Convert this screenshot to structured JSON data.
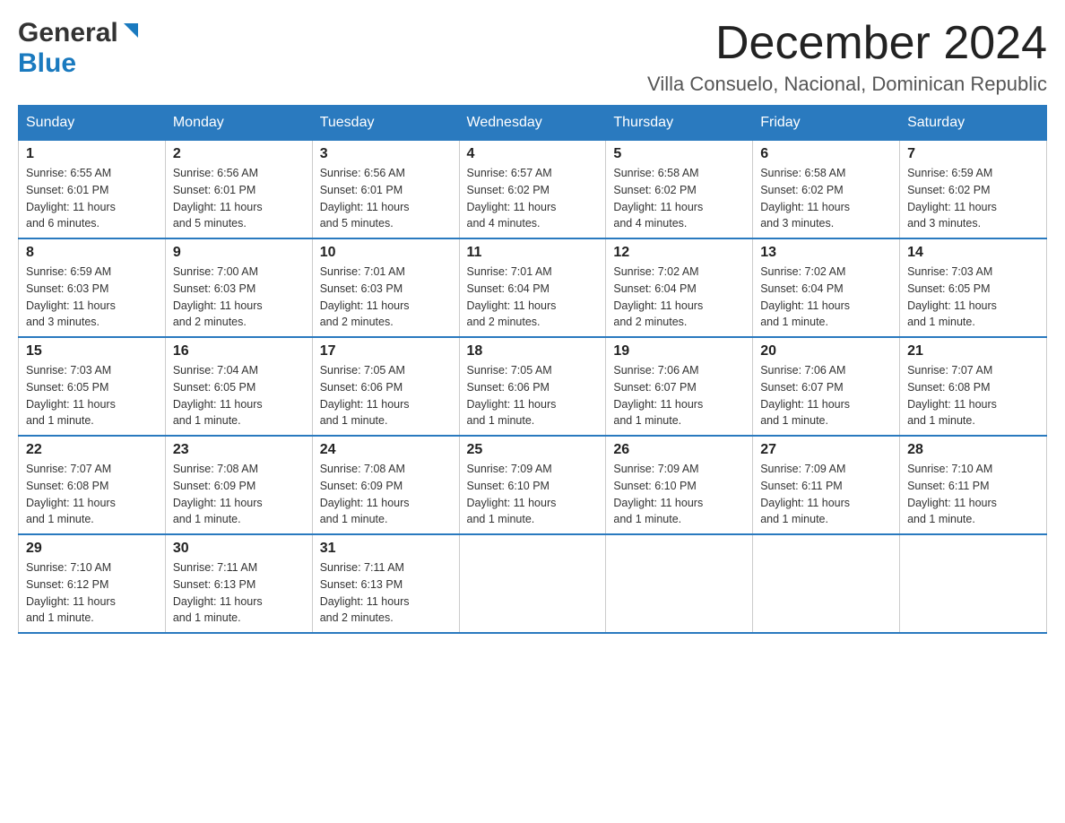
{
  "header": {
    "logo_general": "General",
    "logo_blue": "Blue",
    "month_title": "December 2024",
    "location": "Villa Consuelo, Nacional, Dominican Republic"
  },
  "days_of_week": [
    "Sunday",
    "Monday",
    "Tuesday",
    "Wednesday",
    "Thursday",
    "Friday",
    "Saturday"
  ],
  "weeks": [
    [
      {
        "day": "1",
        "sunrise": "Sunrise: 6:55 AM",
        "sunset": "Sunset: 6:01 PM",
        "daylight": "Daylight: 11 hours and 6 minutes."
      },
      {
        "day": "2",
        "sunrise": "Sunrise: 6:56 AM",
        "sunset": "Sunset: 6:01 PM",
        "daylight": "Daylight: 11 hours and 5 minutes."
      },
      {
        "day": "3",
        "sunrise": "Sunrise: 6:56 AM",
        "sunset": "Sunset: 6:01 PM",
        "daylight": "Daylight: 11 hours and 5 minutes."
      },
      {
        "day": "4",
        "sunrise": "Sunrise: 6:57 AM",
        "sunset": "Sunset: 6:02 PM",
        "daylight": "Daylight: 11 hours and 4 minutes."
      },
      {
        "day": "5",
        "sunrise": "Sunrise: 6:58 AM",
        "sunset": "Sunset: 6:02 PM",
        "daylight": "Daylight: 11 hours and 4 minutes."
      },
      {
        "day": "6",
        "sunrise": "Sunrise: 6:58 AM",
        "sunset": "Sunset: 6:02 PM",
        "daylight": "Daylight: 11 hours and 3 minutes."
      },
      {
        "day": "7",
        "sunrise": "Sunrise: 6:59 AM",
        "sunset": "Sunset: 6:02 PM",
        "daylight": "Daylight: 11 hours and 3 minutes."
      }
    ],
    [
      {
        "day": "8",
        "sunrise": "Sunrise: 6:59 AM",
        "sunset": "Sunset: 6:03 PM",
        "daylight": "Daylight: 11 hours and 3 minutes."
      },
      {
        "day": "9",
        "sunrise": "Sunrise: 7:00 AM",
        "sunset": "Sunset: 6:03 PM",
        "daylight": "Daylight: 11 hours and 2 minutes."
      },
      {
        "day": "10",
        "sunrise": "Sunrise: 7:01 AM",
        "sunset": "Sunset: 6:03 PM",
        "daylight": "Daylight: 11 hours and 2 minutes."
      },
      {
        "day": "11",
        "sunrise": "Sunrise: 7:01 AM",
        "sunset": "Sunset: 6:04 PM",
        "daylight": "Daylight: 11 hours and 2 minutes."
      },
      {
        "day": "12",
        "sunrise": "Sunrise: 7:02 AM",
        "sunset": "Sunset: 6:04 PM",
        "daylight": "Daylight: 11 hours and 2 minutes."
      },
      {
        "day": "13",
        "sunrise": "Sunrise: 7:02 AM",
        "sunset": "Sunset: 6:04 PM",
        "daylight": "Daylight: 11 hours and 1 minute."
      },
      {
        "day": "14",
        "sunrise": "Sunrise: 7:03 AM",
        "sunset": "Sunset: 6:05 PM",
        "daylight": "Daylight: 11 hours and 1 minute."
      }
    ],
    [
      {
        "day": "15",
        "sunrise": "Sunrise: 7:03 AM",
        "sunset": "Sunset: 6:05 PM",
        "daylight": "Daylight: 11 hours and 1 minute."
      },
      {
        "day": "16",
        "sunrise": "Sunrise: 7:04 AM",
        "sunset": "Sunset: 6:05 PM",
        "daylight": "Daylight: 11 hours and 1 minute."
      },
      {
        "day": "17",
        "sunrise": "Sunrise: 7:05 AM",
        "sunset": "Sunset: 6:06 PM",
        "daylight": "Daylight: 11 hours and 1 minute."
      },
      {
        "day": "18",
        "sunrise": "Sunrise: 7:05 AM",
        "sunset": "Sunset: 6:06 PM",
        "daylight": "Daylight: 11 hours and 1 minute."
      },
      {
        "day": "19",
        "sunrise": "Sunrise: 7:06 AM",
        "sunset": "Sunset: 6:07 PM",
        "daylight": "Daylight: 11 hours and 1 minute."
      },
      {
        "day": "20",
        "sunrise": "Sunrise: 7:06 AM",
        "sunset": "Sunset: 6:07 PM",
        "daylight": "Daylight: 11 hours and 1 minute."
      },
      {
        "day": "21",
        "sunrise": "Sunrise: 7:07 AM",
        "sunset": "Sunset: 6:08 PM",
        "daylight": "Daylight: 11 hours and 1 minute."
      }
    ],
    [
      {
        "day": "22",
        "sunrise": "Sunrise: 7:07 AM",
        "sunset": "Sunset: 6:08 PM",
        "daylight": "Daylight: 11 hours and 1 minute."
      },
      {
        "day": "23",
        "sunrise": "Sunrise: 7:08 AM",
        "sunset": "Sunset: 6:09 PM",
        "daylight": "Daylight: 11 hours and 1 minute."
      },
      {
        "day": "24",
        "sunrise": "Sunrise: 7:08 AM",
        "sunset": "Sunset: 6:09 PM",
        "daylight": "Daylight: 11 hours and 1 minute."
      },
      {
        "day": "25",
        "sunrise": "Sunrise: 7:09 AM",
        "sunset": "Sunset: 6:10 PM",
        "daylight": "Daylight: 11 hours and 1 minute."
      },
      {
        "day": "26",
        "sunrise": "Sunrise: 7:09 AM",
        "sunset": "Sunset: 6:10 PM",
        "daylight": "Daylight: 11 hours and 1 minute."
      },
      {
        "day": "27",
        "sunrise": "Sunrise: 7:09 AM",
        "sunset": "Sunset: 6:11 PM",
        "daylight": "Daylight: 11 hours and 1 minute."
      },
      {
        "day": "28",
        "sunrise": "Sunrise: 7:10 AM",
        "sunset": "Sunset: 6:11 PM",
        "daylight": "Daylight: 11 hours and 1 minute."
      }
    ],
    [
      {
        "day": "29",
        "sunrise": "Sunrise: 7:10 AM",
        "sunset": "Sunset: 6:12 PM",
        "daylight": "Daylight: 11 hours and 1 minute."
      },
      {
        "day": "30",
        "sunrise": "Sunrise: 7:11 AM",
        "sunset": "Sunset: 6:13 PM",
        "daylight": "Daylight: 11 hours and 1 minute."
      },
      {
        "day": "31",
        "sunrise": "Sunrise: 7:11 AM",
        "sunset": "Sunset: 6:13 PM",
        "daylight": "Daylight: 11 hours and 2 minutes."
      },
      null,
      null,
      null,
      null
    ]
  ]
}
